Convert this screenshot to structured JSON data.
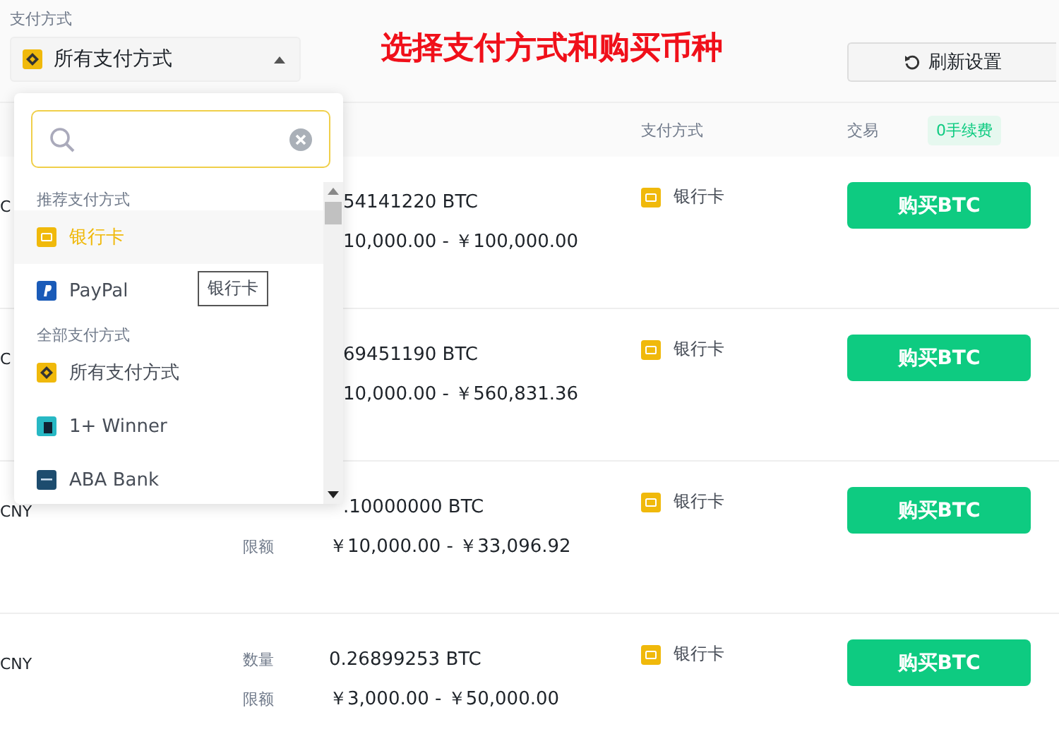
{
  "filter": {
    "label": "支付方式",
    "value": "所有支付方式",
    "expanded": true
  },
  "headline": "选择支付方式和购买币种",
  "refresh_button": "刷新设置",
  "table": {
    "columns": [
      {
        "label": "支付方式"
      },
      {
        "label": "交易"
      }
    ],
    "fee_badge": "0手续费",
    "rows": [
      {
        "currency": "C",
        "amount": "54141220 BTC",
        "limit": "10,000.00 - ￥100,000.00",
        "payment": "银行卡",
        "action": "购买BTC"
      },
      {
        "currency": "C",
        "amount": "69451190 BTC",
        "limit": "10,000.00 - ￥560,831.36",
        "payment": "银行卡",
        "action": "购买BTC"
      },
      {
        "currency": "CNY",
        "amount": ".10000000 BTC",
        "limit_label": "限额",
        "limit": "￥10,000.00 - ￥33,096.92",
        "payment": "银行卡",
        "action": "购买BTC"
      },
      {
        "currency": "CNY",
        "amount_label": "数量",
        "amount": "0.26899253 BTC",
        "limit_label": "限额",
        "limit": "￥3,000.00 - ￥50,000.00",
        "payment": "银行卡",
        "action": "购买BTC"
      }
    ]
  },
  "dropdown": {
    "items": [
      {
        "kind": "header",
        "label": "推荐支付方式"
      },
      {
        "kind": "option",
        "label": "银行卡",
        "selected": true
      },
      {
        "kind": "option",
        "label": "PayPal",
        "selected": false,
        "tooltip": "银行卡"
      },
      {
        "kind": "header",
        "label": "全部支付方式"
      },
      {
        "kind": "option",
        "label": "所有支付方式",
        "selected": false
      },
      {
        "kind": "option",
        "label": "1+ Winner",
        "selected": false
      },
      {
        "kind": "option",
        "label": "ABA Bank",
        "selected": false
      }
    ]
  }
}
